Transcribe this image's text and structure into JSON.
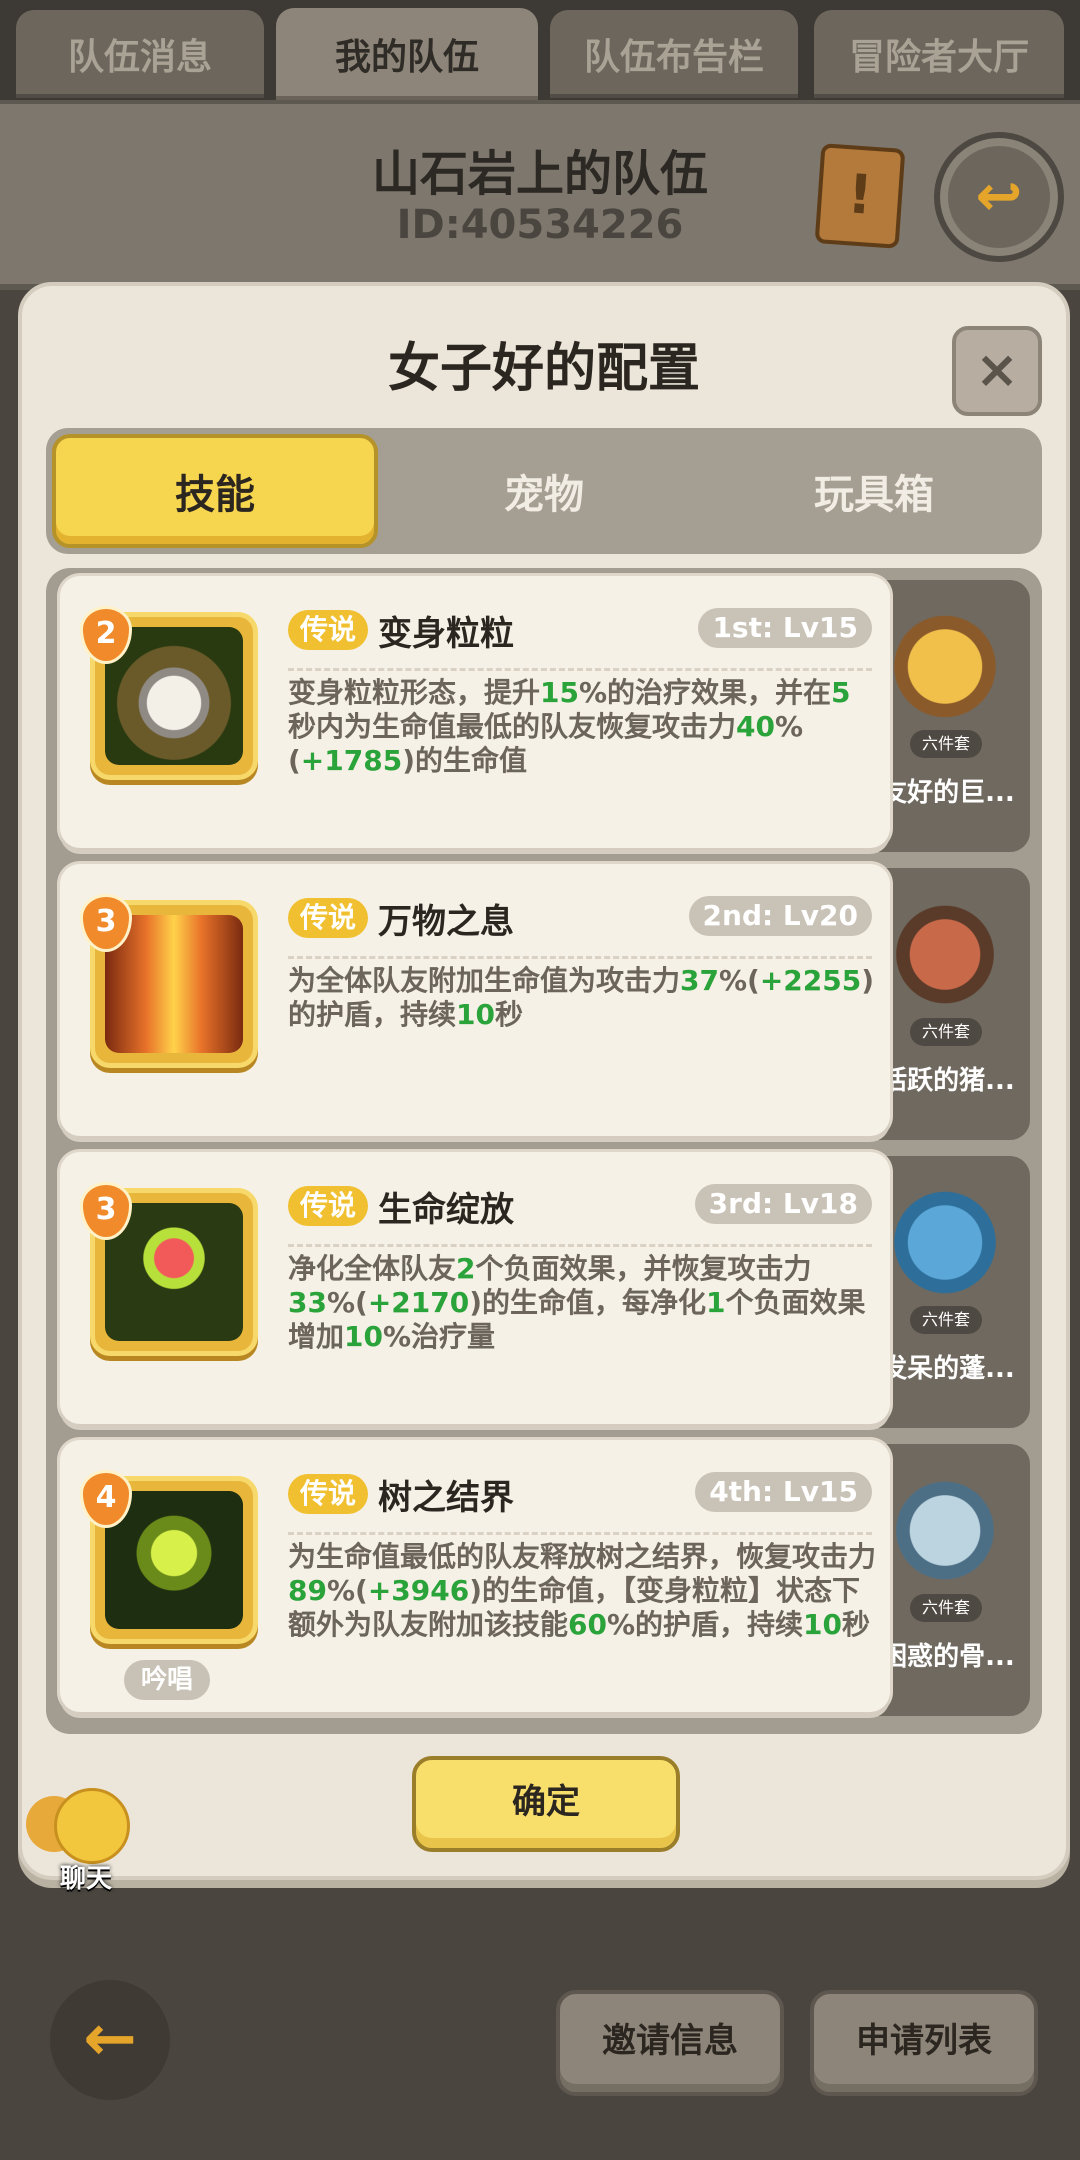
{
  "top_tabs": [
    {
      "label": "队伍消息"
    },
    {
      "label": "我的队伍"
    },
    {
      "label": "队伍布告栏"
    },
    {
      "label": "冒险者大厅"
    }
  ],
  "team": {
    "name": "山石岩上的队伍",
    "id": "ID:40534226"
  },
  "modal": {
    "title": "女子好的配置",
    "close_icon": "×",
    "tabs": [
      {
        "label": "技能"
      },
      {
        "label": "宠物"
      },
      {
        "label": "玩具箱"
      }
    ],
    "confirm_label": "确定"
  },
  "skills": [
    {
      "level": "2",
      "rarity": "传说",
      "name": "变身粒粒",
      "order": "1st: Lv15",
      "desc": "变身粒粒形态，提升15%的治疗效果，并在5秒内为生命值最低的队友恢复攻击力40%(+1785)的生命值",
      "suit_tag": "六件套",
      "suit_name": "友好的巨...",
      "icon": "owl-icon"
    },
    {
      "level": "3",
      "rarity": "传说",
      "name": "万物之息",
      "order": "2nd: Lv20",
      "desc": "为全体队友附加生命值为攻击力37%(+2255)的护盾，持续10秒",
      "suit_tag": "六件套",
      "suit_name": "活跃的猪...",
      "icon": "healing-cross-icon"
    },
    {
      "level": "3",
      "rarity": "传说",
      "name": "生命绽放",
      "order": "3rd: Lv18",
      "desc": "净化全体队友2个负面效果，并恢复攻击力33%(+2170)的生命值，每净化1个负面效果增加10%治疗量",
      "suit_tag": "六件套",
      "suit_name": "发呆的蓬...",
      "icon": "heart-sprout-icon"
    },
    {
      "level": "4",
      "rarity": "传说",
      "name": "树之结界",
      "order": "4th: Lv15",
      "desc": "为生命值最低的队友释放树之结界，恢复攻击力89%(+3946)的生命值，【变身粒粒】状态下额外为队友附加该技能60%的护盾，持续10秒",
      "suit_tag": "六件套",
      "suit_name": "困惑的骨...",
      "icon": "tree-barrier-icon",
      "chant": "吟唱"
    }
  ],
  "chat": {
    "label": "聊天"
  },
  "bottom": {
    "back_icon": "←",
    "invite_label": "邀请信息",
    "apply_label": "申请列表"
  }
}
